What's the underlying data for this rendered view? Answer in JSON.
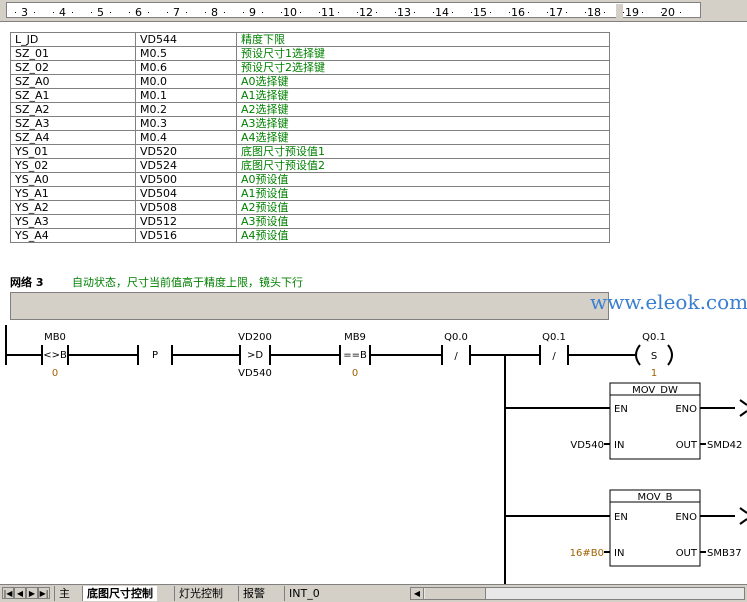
{
  "ruler": {
    "ticks": [
      "3",
      "4",
      "5",
      "6",
      "7",
      "8",
      "9",
      "10",
      "11",
      "12",
      "13",
      "14",
      "15",
      "16",
      "17",
      "18",
      "19",
      "20"
    ]
  },
  "symbols": [
    [
      "L_JD",
      "VD544",
      "精度下限"
    ],
    [
      "SZ_01",
      "M0.5",
      "预设尺寸1选择键"
    ],
    [
      "SZ_02",
      "M0.6",
      "预设尺寸2选择键"
    ],
    [
      "SZ_A0",
      "M0.0",
      "A0选择键"
    ],
    [
      "SZ_A1",
      "M0.1",
      "A1选择键"
    ],
    [
      "SZ_A2",
      "M0.2",
      "A2选择键"
    ],
    [
      "SZ_A3",
      "M0.3",
      "A3选择键"
    ],
    [
      "SZ_A4",
      "M0.4",
      "A4选择键"
    ],
    [
      "YS_01",
      "VD520",
      "底图尺寸预设值1"
    ],
    [
      "YS_02",
      "VD524",
      "底图尺寸预设值2"
    ],
    [
      "YS_A0",
      "VD500",
      "A0预设值"
    ],
    [
      "YS_A1",
      "VD504",
      "A1预设值"
    ],
    [
      "YS_A2",
      "VD508",
      "A2预设值"
    ],
    [
      "YS_A3",
      "VD512",
      "A3预设值"
    ],
    [
      "YS_A4",
      "VD516",
      "A4预设值"
    ]
  ],
  "network": {
    "label": "网络 3",
    "comment": "自动状态，尺寸当前值高于精度上限，镜头下行"
  },
  "watermark": "www.eleok.com",
  "ladder": {
    "c1": {
      "addr": "MB0",
      "op": "<>B",
      "val": "0"
    },
    "c2": {
      "op": "P"
    },
    "c3": {
      "addr": "VD200",
      "op": ">D",
      "val": "VD540"
    },
    "c4": {
      "addr": "MB9",
      "op": "==B",
      "val": "0"
    },
    "c5": {
      "addr": "Q0.0",
      "op": "/"
    },
    "c6": {
      "addr": "Q0.1",
      "op": "/"
    },
    "coil": {
      "addr": "Q0.1",
      "op": "S",
      "val": "1"
    },
    "box1": {
      "title": "MOV_DW",
      "en": "EN",
      "eno": "ENO",
      "in": "IN",
      "out": "OUT",
      "in_val": "VD540",
      "out_val": "SMD42"
    },
    "box2": {
      "title": "MOV_B",
      "en": "EN",
      "eno": "ENO",
      "in": "IN",
      "out": "OUT",
      "in_val": "16#B0",
      "out_val": "SMB37"
    }
  },
  "tabs": [
    "主",
    "底图尺寸控制",
    "灯光控制",
    "报警",
    "INT_0"
  ],
  "colors": {
    "comment_green": "#008000",
    "value_brown": "#a06000",
    "watermark_blue": "#3a7fd0",
    "chrome_gray": "#d4d0c8"
  },
  "icons": [
    "first-icon",
    "prev-icon",
    "next-icon",
    "last-icon",
    "scroll-left-icon"
  ]
}
